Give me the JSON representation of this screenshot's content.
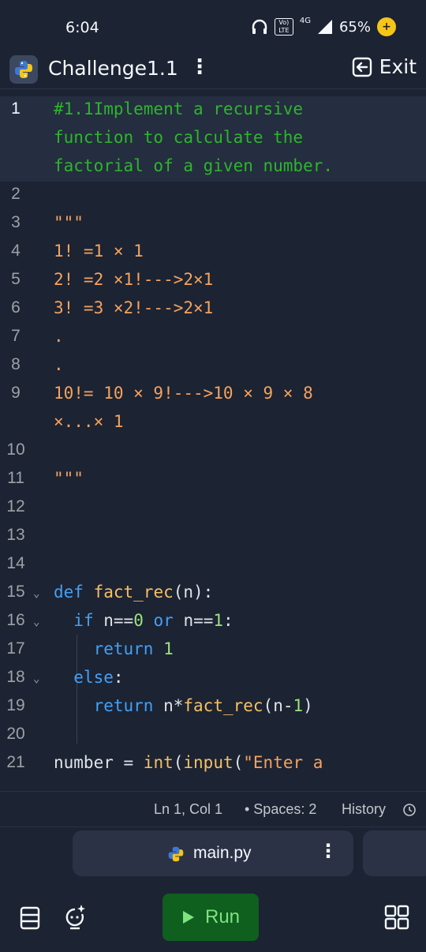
{
  "status_bar": {
    "time": "6:04",
    "volte": "Vo) LTE",
    "network": "4G",
    "battery": "65%"
  },
  "header": {
    "title": "Challenge1.1",
    "exit_label": "Exit"
  },
  "editor": {
    "lines": [
      {
        "n": "1",
        "text": "#1.1Implement a recursive"
      },
      {
        "n": "",
        "text": "function to calculate the"
      },
      {
        "n": "",
        "text": "factorial of a given number."
      },
      {
        "n": "2",
        "text": ""
      },
      {
        "n": "3",
        "text": "\"\"\""
      },
      {
        "n": "4",
        "text": "1! =1 × 1"
      },
      {
        "n": "5",
        "text": "2! =2 ×1!--->2×1"
      },
      {
        "n": "6",
        "text": "3! =3 ×2!--->2×1"
      },
      {
        "n": "7",
        "text": "."
      },
      {
        "n": "8",
        "text": "."
      },
      {
        "n": "9",
        "text": "10!= 10 × 9!--->10 × 9 × 8"
      },
      {
        "n": "",
        "text": "×...× 1"
      },
      {
        "n": "10",
        "text": ""
      },
      {
        "n": "11",
        "text": "\"\"\""
      },
      {
        "n": "12",
        "text": ""
      },
      {
        "n": "13",
        "text": ""
      },
      {
        "n": "14",
        "text": ""
      },
      {
        "n": "15",
        "text": "def fact_rec(n):"
      },
      {
        "n": "16",
        "text": "  if n==0 or n==1:"
      },
      {
        "n": "17",
        "text": "    return 1"
      },
      {
        "n": "18",
        "text": "  else:"
      },
      {
        "n": "19",
        "text": "    return n*fact_rec(n-1)"
      },
      {
        "n": "20",
        "text": ""
      },
      {
        "n": "21",
        "text": "number = int(input(\"Enter a"
      }
    ]
  },
  "status_strip": {
    "position": "Ln 1, Col 1",
    "spaces": "• Spaces: 2",
    "history": "History"
  },
  "file_tab": {
    "name": "main.py"
  },
  "bottom_bar": {
    "run_label": "Run"
  },
  "colors": {
    "background": "#1c2333",
    "comment": "#2db52d",
    "keyword": "#43a0f5",
    "run_button": "#0f5f1f"
  }
}
